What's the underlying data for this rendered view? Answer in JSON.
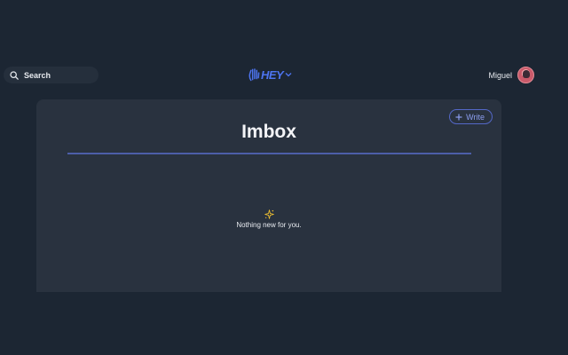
{
  "header": {
    "search_label": "Search",
    "logo_text": "HEY",
    "user_name": "Miguel"
  },
  "main": {
    "write_label": "Write",
    "title": "Imbox",
    "empty_message": "Nothing new for you."
  },
  "icons": {
    "search": "search-icon",
    "logo_hand": "hey-hand-logo-icon",
    "chevron": "chevron-down-icon",
    "write": "plus-icon",
    "sparkle": "sparkle-icon"
  },
  "colors": {
    "background": "#1c2633",
    "panel": "#29323f",
    "accent": "#4d74f0",
    "sparkle": "#f2c230"
  }
}
